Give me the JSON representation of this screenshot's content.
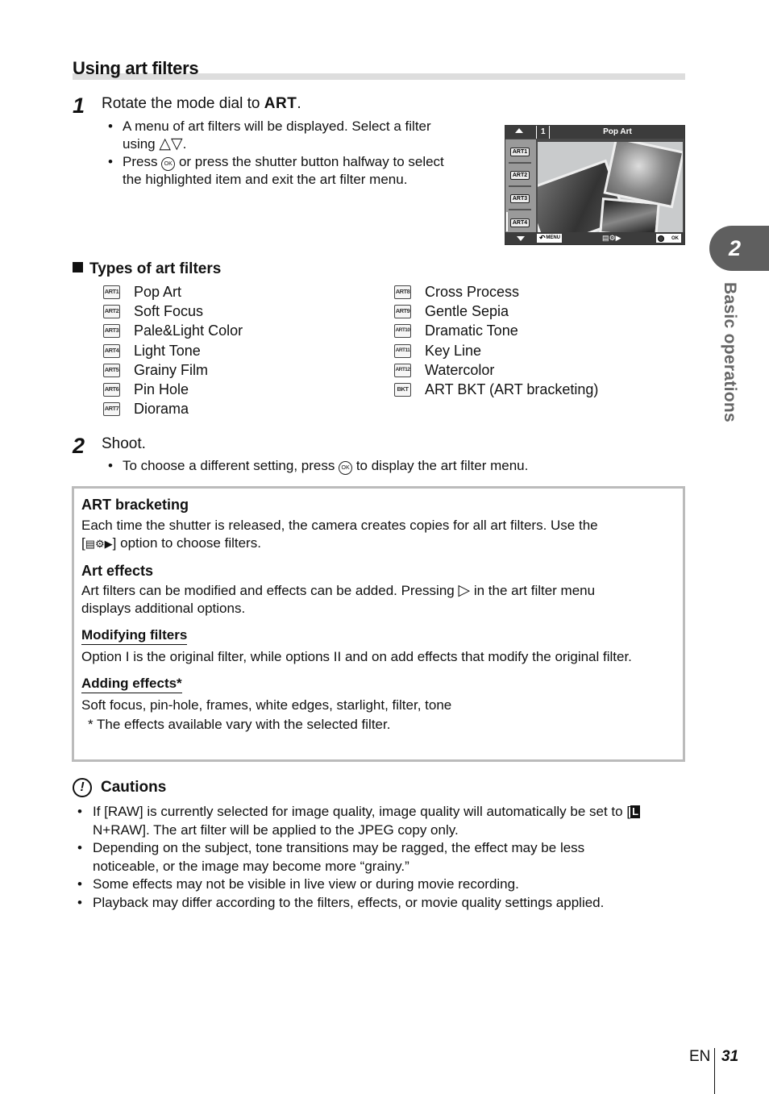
{
  "section_title": "Using art filters",
  "step1": {
    "number": "1",
    "text_prefix": "Rotate the mode dial to ",
    "text_mode": "ART",
    "text_suffix": ".",
    "bullets": [
      {
        "part1": "A menu of art filters will be displayed. Select a filter",
        "part2": "using",
        "arrows": "△▽",
        "end": "."
      },
      {
        "part1": "Press",
        "ok": "OK",
        "part2": "or press the shutter button halfway to select",
        "part3": "the highlighted item and exit the art filter menu."
      }
    ]
  },
  "camera_screen": {
    "index": "1",
    "filter_name": "Pop Art",
    "icons": [
      "ART1",
      "ART2",
      "ART3",
      "ART4"
    ],
    "menu_label": "MENU",
    "ok_label": "OK",
    "settings_icon": "▤⚙▶"
  },
  "types": {
    "title": "Types of art filters",
    "left": [
      {
        "icon": "ART1",
        "label": "Pop Art"
      },
      {
        "icon": "ART2",
        "label": "Soft Focus"
      },
      {
        "icon": "ART3",
        "label": "Pale&Light Color"
      },
      {
        "icon": "ART4",
        "label": "Light Tone"
      },
      {
        "icon": "ART5",
        "label": "Grainy Film"
      },
      {
        "icon": "ART6",
        "label": "Pin Hole"
      },
      {
        "icon": "ART7",
        "label": "Diorama"
      }
    ],
    "right": [
      {
        "icon": "ART8",
        "label": "Cross Process"
      },
      {
        "icon": "ART9",
        "label": "Gentle Sepia"
      },
      {
        "icon": "ART10",
        "label": "Dramatic Tone"
      },
      {
        "icon": "ART11",
        "label": "Key Line"
      },
      {
        "icon": "ART12",
        "label": "Watercolor"
      },
      {
        "icon": "BKT",
        "label": "ART BKT (ART bracketing)"
      }
    ]
  },
  "step2": {
    "number": "2",
    "text": "Shoot.",
    "bullet_part1": "To choose a different setting, press",
    "ok": "OK",
    "bullet_part2": "to display the art filter menu."
  },
  "infobox": {
    "bracketing_title": "ART bracketing",
    "bracketing_text1": "Each time the shutter is released, the camera creates copies for all art filters. Use the",
    "bracketing_text2_open": "[",
    "bracketing_icon": "▤⚙▶",
    "bracketing_text2_close": "] option to choose filters.",
    "effects_title": "Art effects",
    "effects_text1": "Art filters can be modified and effects can be added. Pressing",
    "effects_arrow": "▷",
    "effects_text2": "in the art filter menu",
    "effects_text3": "displays additional options.",
    "modifying_title": "Modifying filters",
    "modifying_text": "Option I is the original filter, while options II and on add effects that modify the original filter.",
    "adding_title": "Adding effects*",
    "adding_text": "Soft focus, pin-hole, frames, white edges, starlight, filter, tone",
    "adding_note": "*  The effects available vary with the selected filter."
  },
  "cautions": {
    "title": "Cautions",
    "items": [
      {
        "a": "If [RAW] is currently selected for image quality, image quality will automatically be set to",
        "b_open": "[",
        "b_icon": "L",
        "b_rest": "N+RAW]. The art filter will be applied to the JPEG copy only."
      },
      {
        "text": "Depending on the subject, tone transitions may be ragged, the effect may be less noticeable, or the image may become more “grainy.”"
      },
      {
        "text": "Some effects may not be visible in live view or during movie recording."
      },
      {
        "text": "Playback may differ according to the filters, effects, or movie quality settings applied."
      }
    ]
  },
  "side_tab": {
    "chapter": "2",
    "label": "Basic operations"
  },
  "footer": {
    "lang": "EN",
    "page": "31"
  }
}
